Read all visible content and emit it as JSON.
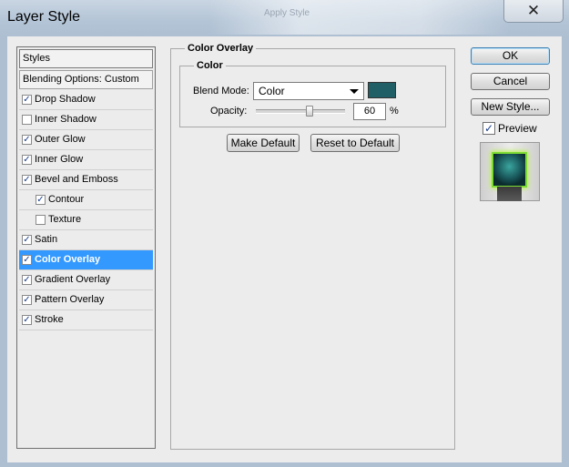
{
  "window": {
    "title": "Layer Style",
    "close_glyph": "✕",
    "background_ghost_text": "Apply Style"
  },
  "styles_panel": {
    "header": "Styles",
    "blending_options": "Blending Options: Custom",
    "effects": [
      {
        "label": "Drop Shadow",
        "checked": true,
        "indent": false,
        "selected": false
      },
      {
        "label": "Inner Shadow",
        "checked": false,
        "indent": false,
        "selected": false
      },
      {
        "label": "Outer Glow",
        "checked": true,
        "indent": false,
        "selected": false
      },
      {
        "label": "Inner Glow",
        "checked": true,
        "indent": false,
        "selected": false
      },
      {
        "label": "Bevel and Emboss",
        "checked": true,
        "indent": false,
        "selected": false
      },
      {
        "label": "Contour",
        "checked": true,
        "indent": true,
        "selected": false
      },
      {
        "label": "Texture",
        "checked": false,
        "indent": true,
        "selected": false
      },
      {
        "label": "Satin",
        "checked": true,
        "indent": false,
        "selected": false
      },
      {
        "label": "Color Overlay",
        "checked": true,
        "indent": false,
        "selected": true
      },
      {
        "label": "Gradient Overlay",
        "checked": true,
        "indent": false,
        "selected": false
      },
      {
        "label": "Pattern Overlay",
        "checked": true,
        "indent": false,
        "selected": false
      },
      {
        "label": "Stroke",
        "checked": true,
        "indent": false,
        "selected": false
      }
    ]
  },
  "color_overlay": {
    "section_title": "Color Overlay",
    "group_title": "Color",
    "blend_mode_label": "Blend Mode:",
    "blend_mode_value": "Color",
    "overlay_color": "#1f5f65",
    "opacity_label": "Opacity:",
    "opacity_value": "60",
    "opacity_unit": "%",
    "opacity_fraction": 0.6,
    "make_default": "Make Default",
    "reset_default": "Reset to Default"
  },
  "actions": {
    "ok": "OK",
    "cancel": "Cancel",
    "new_style": "New Style...",
    "preview_label": "Preview",
    "preview_checked": true
  },
  "colors": {
    "selection": "#3399ff",
    "check": "#1a3d8a"
  }
}
